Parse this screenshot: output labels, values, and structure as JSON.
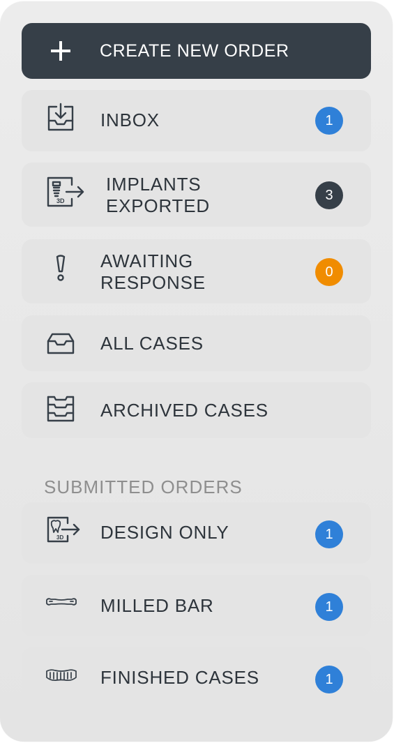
{
  "create_button": {
    "label": "CREATE NEW ORDER",
    "icon": "plus-icon"
  },
  "nav": {
    "inbox": {
      "label": "INBOX",
      "icon": "inbox-download-icon",
      "count": "1",
      "badge_color": "#2f80d8"
    },
    "implants_exported": {
      "label_line1": "IMPLANTS",
      "label_line2": "EXPORTED",
      "icon": "implant-3d-export-icon",
      "count": "3",
      "badge_color": "#363f48"
    },
    "awaiting_response": {
      "label_line1": "AWAITING",
      "label_line2": "RESPONSE",
      "icon": "exclamation-icon",
      "count": "0",
      "badge_color": "#f08c00"
    },
    "all_cases": {
      "label": "ALL CASES",
      "icon": "tray-icon"
    },
    "archived_cases": {
      "label": "ARCHIVED CASES",
      "icon": "archive-stack-icon"
    }
  },
  "submitted": {
    "title": "SUBMITTED ORDERS",
    "design_only": {
      "label": "DESIGN ONLY",
      "icon": "tooth-3d-export-icon",
      "count": "1",
      "badge_color": "#2f80d8"
    },
    "milled_bar": {
      "label": "MILLED BAR",
      "icon": "milled-bar-icon",
      "count": "1",
      "badge_color": "#2f80d8"
    },
    "finished_cases": {
      "label": "FINISHED CASES",
      "icon": "denture-icon",
      "count": "1",
      "badge_color": "#2f80d8"
    }
  },
  "colors": {
    "panel": "#e9e9e9",
    "item": "#e4e4e4",
    "primary_button": "#363f48",
    "text": "#2d343b",
    "section_title": "#8e8e8e"
  }
}
